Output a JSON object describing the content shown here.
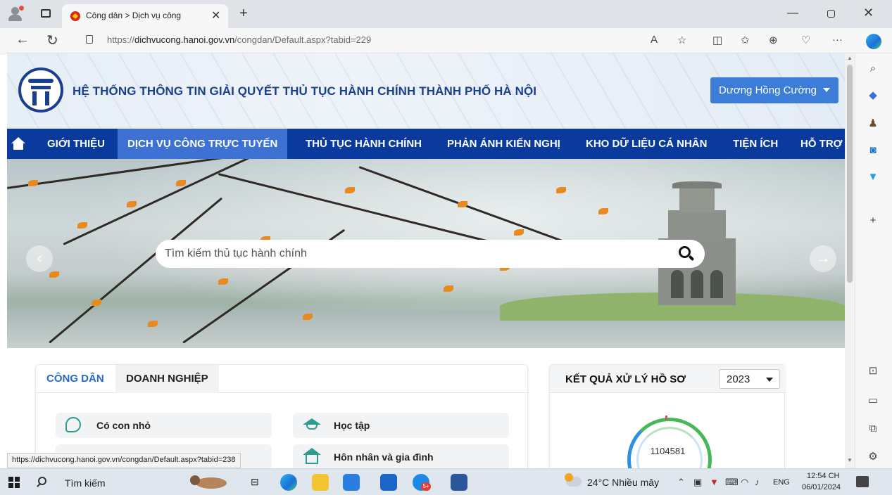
{
  "browser": {
    "tab_title": "Công dân > Dịch vụ công",
    "tab_close": "✕",
    "new_tab": "+",
    "url_prefix": "https://",
    "url_host": "dichvucong.hanoi.gov.vn",
    "url_path": "/congdan/Default.aspx?tabid=229",
    "toolbar_icons": [
      "read-aloud-icon",
      "favorite-star-icon",
      "split-screen-icon",
      "favorites-icon",
      "collections-icon",
      "browser-essentials-icon",
      "more-icon"
    ],
    "sidebar_icons": [
      "search-icon",
      "shopping-tag-icon",
      "games-icon",
      "outlook-icon",
      "drop-icon",
      "add-icon",
      "screenshot-icon",
      "layout-icon",
      "open-external-icon",
      "settings-icon"
    ],
    "status_link": "https://dichvucong.hanoi.gov.vn/congdan/Default.aspx?tabid=238"
  },
  "header": {
    "site_title": "HỆ THỐNG THÔNG TIN GIẢI QUYẾT THỦ TỤC HÀNH CHÍNH THÀNH PHỐ HÀ NỘI",
    "user_name": "Dương Hồng Cường"
  },
  "menu": {
    "items": [
      {
        "label": "GIỚI THIỆU"
      },
      {
        "label": "DỊCH VỤ CÔNG TRỰC TUYẾN"
      },
      {
        "label": "THỦ TỤC HÀNH CHÍNH"
      },
      {
        "label": "PHẢN ÁNH KIẾN NGHỊ"
      },
      {
        "label": "KHO DỮ LIỆU CÁ NHÂN"
      },
      {
        "label": "TIỆN ÍCH"
      },
      {
        "label": "HỖ TRỢ"
      }
    ]
  },
  "banner": {
    "search_placeholder": "Tìm kiếm thủ tục hành chính"
  },
  "left_panel": {
    "tabs": [
      {
        "label": "CÔNG DÂN"
      },
      {
        "label": "DOANH NGHIỆP"
      }
    ],
    "categories": [
      {
        "label": "Có con nhỏ"
      },
      {
        "label": "Học tập"
      },
      {
        "label": "Hôn nhân và gia đình"
      }
    ]
  },
  "right_panel": {
    "title": "KẾT QUẢ XỬ LÝ HỒ SƠ",
    "year": "2023",
    "total": "1104581"
  },
  "taskbar": {
    "search_label": "Tìm kiếm",
    "weather": "24°C  Nhiều mây",
    "language": "ENG",
    "time": "12:54 CH",
    "date": "06/01/2024",
    "badge": "5+"
  },
  "colors": {
    "nav_blue": "#0b3a9e",
    "nav_active": "#3d72d4",
    "title_blue": "#1a3f8f",
    "user_button": "#3b7dd8",
    "tab_active_text": "#2769c9"
  }
}
